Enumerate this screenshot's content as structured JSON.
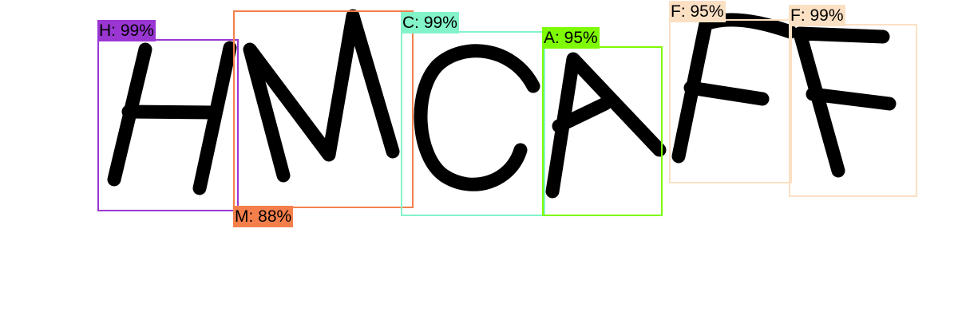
{
  "image": {
    "captcha_text": "HMCAFF"
  },
  "detections": [
    {
      "letter": "H",
      "label": "H: 99%",
      "color": "#9a37d3"
    },
    {
      "letter": "M",
      "label": "M: 88%",
      "color": "#f57f4b"
    },
    {
      "letter": "C",
      "label": "C: 99%",
      "color": "#83f3c9"
    },
    {
      "letter": "A",
      "label": "A: 95%",
      "color": "#7dfa04"
    },
    {
      "letter": "F",
      "label": "F: 95%",
      "color": "#fbe0c4"
    },
    {
      "letter": "F",
      "label": "F: 99%",
      "color": "#fbe0c4"
    }
  ]
}
